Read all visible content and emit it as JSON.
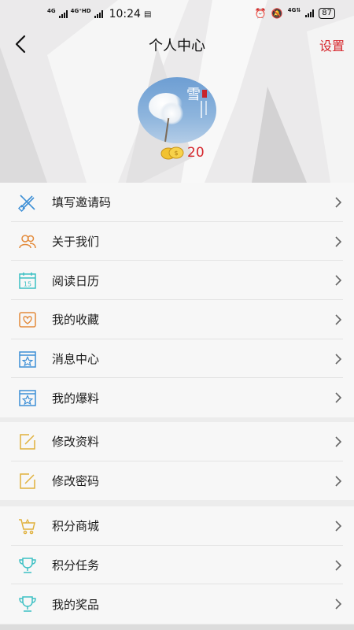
{
  "status_bar": {
    "net1": "4G",
    "net2": "4G⁺HD",
    "time": "10:24",
    "net3": "4G⇅",
    "battery": "87"
  },
  "nav": {
    "title": "个人中心",
    "settings_label": "设置"
  },
  "profile": {
    "points": "20",
    "avatar_text": "雪"
  },
  "menu_groups": [
    [
      {
        "label": "填写邀请码",
        "icon": "pencil-ruler-icon"
      },
      {
        "label": "关于我们",
        "icon": "people-icon"
      },
      {
        "label": "阅读日历",
        "icon": "calendar-icon"
      },
      {
        "label": "我的收藏",
        "icon": "heart-box-icon"
      },
      {
        "label": "消息中心",
        "icon": "star-box-icon"
      },
      {
        "label": "我的爆料",
        "icon": "star-box-icon"
      }
    ],
    [
      {
        "label": "修改资料",
        "icon": "edit-icon"
      },
      {
        "label": "修改密码",
        "icon": "edit-icon"
      }
    ],
    [
      {
        "label": "积分商城",
        "icon": "cart-icon"
      },
      {
        "label": "积分任务",
        "icon": "trophy-icon"
      },
      {
        "label": "我的奖品",
        "icon": "trophy-icon"
      }
    ]
  ],
  "calendar_day": "15",
  "colors": {
    "accent": "#d6262c",
    "icon_blue": "#3d8fd6",
    "icon_orange": "#e38a3a",
    "icon_teal": "#3cc0c4",
    "icon_yellow": "#e0b13c"
  }
}
